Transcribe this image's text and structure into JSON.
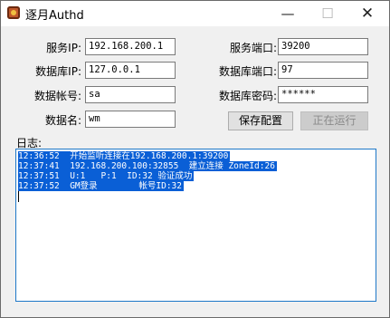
{
  "window": {
    "title": "逐月Authd"
  },
  "controls": {
    "minimize": "—",
    "maximize": "☐",
    "close": "✕"
  },
  "form": {
    "server_ip_label": "服务IP:",
    "server_ip_value": "192.168.200.1",
    "server_port_label": "服务端口:",
    "server_port_value": "39200",
    "db_ip_label": "数据库IP:",
    "db_ip_value": "127.0.0.1",
    "db_port_label": "数据库端口:",
    "db_port_value": "97",
    "db_account_label": "数据帐号:",
    "db_account_value": "sa",
    "db_password_label": "数据库密码:",
    "db_password_value": "******",
    "db_name_label": "数据名:",
    "db_name_value": "wm"
  },
  "buttons": {
    "save_config": "保存配置",
    "running": "正在运行"
  },
  "log": {
    "label": "日志:",
    "lines": [
      "12:36:52  开始监听连接在192.168.200.1:39200",
      "12:37:41  192.168.200.100:32855  建立连接 ZoneId:26",
      "12:37:51  U:1   P:1  ID:32 验证成功",
      "12:37:52  GM登录        帐号ID:32"
    ]
  }
}
